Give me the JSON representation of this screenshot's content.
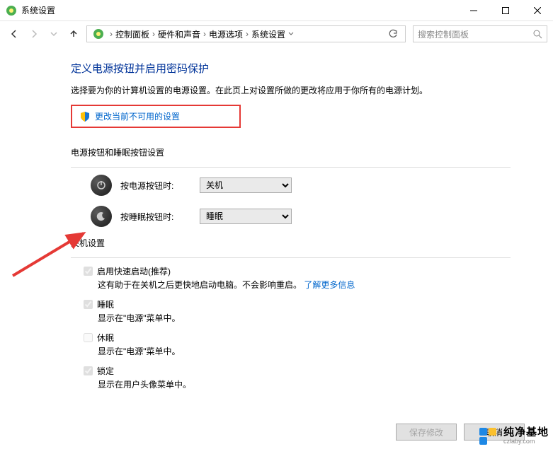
{
  "titlebar": {
    "title": "系统设置"
  },
  "breadcrumb": {
    "items": [
      "控制面板",
      "硬件和声音",
      "电源选项",
      "系统设置"
    ]
  },
  "search": {
    "placeholder": "搜索控制面板"
  },
  "main": {
    "heading": "定义电源按钮并启用密码保护",
    "subtext": "选择要为你的计算机设置的电源设置。在此页上对设置所做的更改将应用于你所有的电源计划。",
    "admin_link": "更改当前不可用的设置",
    "section_buttons": "电源按钮和睡眠按钮设置",
    "power_btn_label": "按电源按钮时:",
    "power_btn_value": "关机",
    "sleep_btn_label": "按睡眠按钮时:",
    "sleep_btn_value": "睡眠",
    "section_shutdown": "关机设置",
    "cb_faststart_label": "启用快速启动(推荐)",
    "cb_faststart_desc_a": "这有助于在关机之后更快地启动电脑。不会影响重启。",
    "cb_faststart_desc_link": "了解更多信息",
    "cb_sleep_label": "睡眠",
    "cb_sleep_desc": "显示在\"电源\"菜单中。",
    "cb_hibernate_label": "休眠",
    "cb_hibernate_desc": "显示在\"电源\"菜单中。",
    "cb_lock_label": "锁定",
    "cb_lock_desc": "显示在用户头像菜单中。"
  },
  "footer": {
    "save": "保存修改",
    "cancel": "取消"
  },
  "watermark": {
    "name": "纯净基地",
    "url": "czlaby.com"
  }
}
